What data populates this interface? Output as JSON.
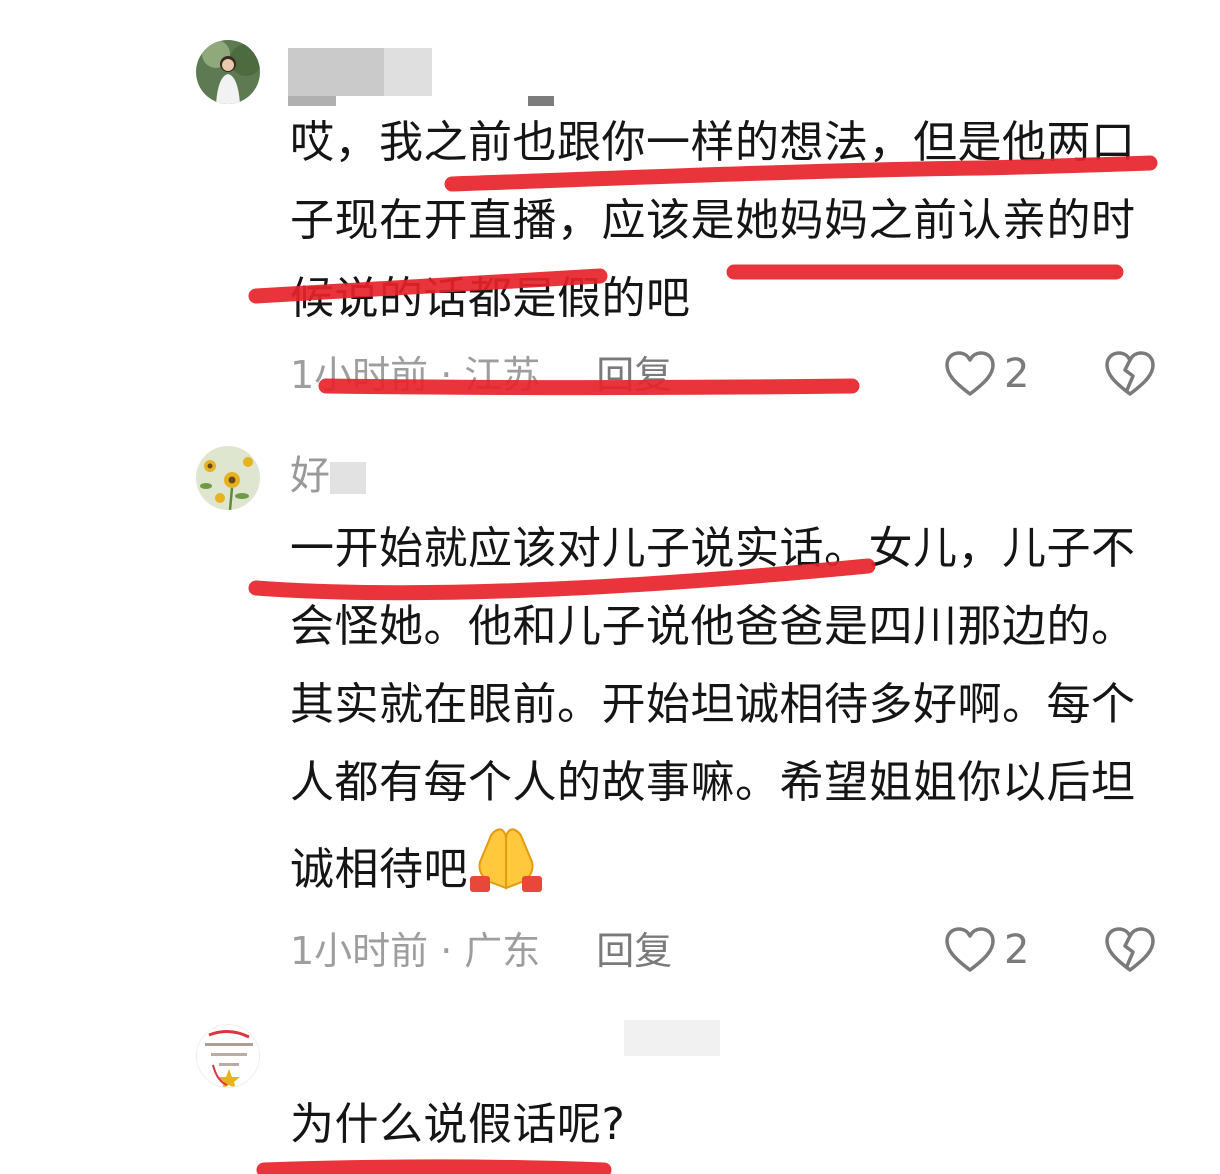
{
  "comments": [
    {
      "username": "",
      "text": "哎，我之前也跟你一样的想法，但是他两口子现在开直播，应该是她妈妈之前认亲的时候说的话都是假的吧",
      "time": "1小时前",
      "location": "江苏",
      "reply": "回复",
      "likes": "2"
    },
    {
      "username": "好",
      "text": "一开始就应该对儿子说实话。女儿，儿子不会怪她。他和儿子说他爸爸是四川那边的。其实就在眼前。开始坦诚相待多好啊。每个人都有每个人的故事嘛。希望姐姐你以后坦诚相待吧",
      "time": "1小时前",
      "location": "广东",
      "reply": "回复",
      "likes": "2"
    },
    {
      "username": "",
      "text": "为什么说假话呢?"
    }
  ],
  "colors": {
    "annotation": "#e8232b",
    "meta": "#9e9e9e",
    "text": "#151515"
  },
  "icons": {
    "like": "heart-outline-icon",
    "dislike": "broken-heart-icon",
    "emoji": "folded-hands-emoji"
  }
}
